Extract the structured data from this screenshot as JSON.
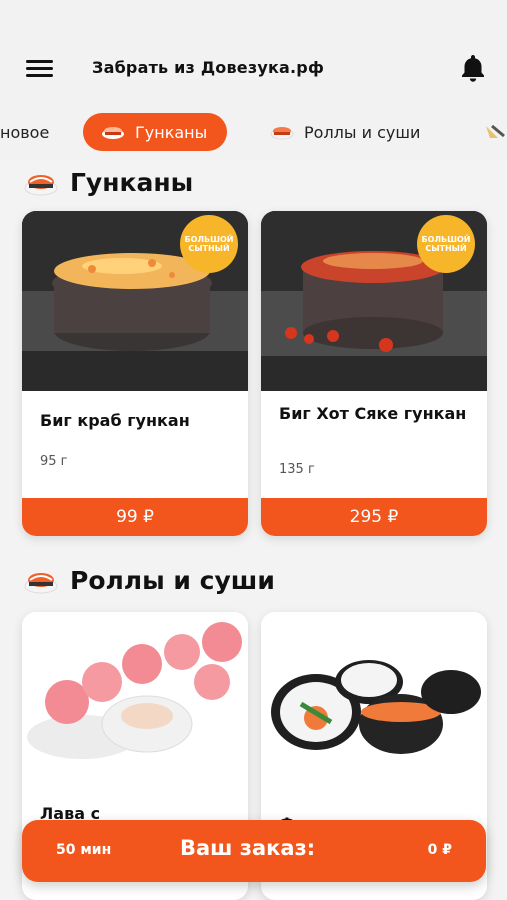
{
  "header": {
    "title": "Забрать из Довезука.рф",
    "menu_icon": "hamburger-menu-icon",
    "bell_icon": "bell-icon"
  },
  "tabs": [
    {
      "label": "новое",
      "active": false
    },
    {
      "label": "Гунканы",
      "active": true
    },
    {
      "label": "Роллы и суши",
      "active": false
    }
  ],
  "sections": [
    {
      "title": "Гунканы",
      "products": [
        {
          "name": "Биг краб гункан",
          "weight": "95 г",
          "price": "99 ₽",
          "badge": [
            "БОЛЬШОЙ",
            "СЫТНЫЙ"
          ]
        },
        {
          "name": "Биг Хот Сяке гункан",
          "weight": "135 г",
          "price": "295 ₽",
          "badge": [
            "БОЛЬШОЙ",
            "СЫТНЫЙ"
          ]
        }
      ]
    },
    {
      "title": "Роллы и суши",
      "products": [
        {
          "name": "Лава с"
        },
        {
          "name": "Филе с тунцом"
        }
      ]
    }
  ],
  "order_bar": {
    "time": "50 мин",
    "label": "Ваш заказ:",
    "total": "0 ₽"
  },
  "colors": {
    "accent": "#f2561c",
    "badge": "#f7b52a",
    "background": "#f3f3f3"
  }
}
